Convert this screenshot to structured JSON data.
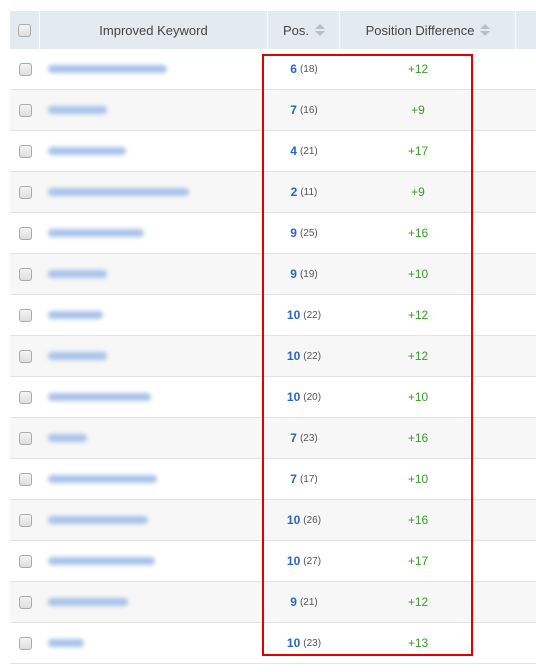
{
  "header": {
    "keyword_label": "Improved Keyword",
    "pos_label": "Pos.",
    "diff_label": "Position Difference"
  },
  "rows": [
    {
      "keyword": "[blurred]",
      "kw_len": 0.52,
      "pos": "6",
      "prev": "(18)",
      "diff": "+12"
    },
    {
      "keyword": "[blurred]",
      "kw_len": 0.26,
      "pos": "7",
      "prev": "(16)",
      "diff": "+9"
    },
    {
      "keyword": "[blurred]",
      "kw_len": 0.34,
      "pos": "4",
      "prev": "(21)",
      "diff": "+17"
    },
    {
      "keyword": "[blurred]",
      "kw_len": 0.62,
      "pos": "2",
      "prev": "(11)",
      "diff": "+9"
    },
    {
      "keyword": "[blurred]",
      "kw_len": 0.42,
      "pos": "9",
      "prev": "(25)",
      "diff": "+16"
    },
    {
      "keyword": "[blurred]",
      "kw_len": 0.26,
      "pos": "9",
      "prev": "(19)",
      "diff": "+10"
    },
    {
      "keyword": "[blurred]",
      "kw_len": 0.24,
      "pos": "10",
      "prev": "(22)",
      "diff": "+12"
    },
    {
      "keyword": "[blurred]",
      "kw_len": 0.26,
      "pos": "10",
      "prev": "(22)",
      "diff": "+12"
    },
    {
      "keyword": "[blurred]",
      "kw_len": 0.45,
      "pos": "10",
      "prev": "(20)",
      "diff": "+10"
    },
    {
      "keyword": "[blurred]",
      "kw_len": 0.17,
      "pos": "7",
      "prev": "(23)",
      "diff": "+16"
    },
    {
      "keyword": "[blurred]",
      "kw_len": 0.48,
      "pos": "7",
      "prev": "(17)",
      "diff": "+10"
    },
    {
      "keyword": "[blurred]",
      "kw_len": 0.44,
      "pos": "10",
      "prev": "(26)",
      "diff": "+16"
    },
    {
      "keyword": "[blurred]",
      "kw_len": 0.47,
      "pos": "10",
      "prev": "(27)",
      "diff": "+17"
    },
    {
      "keyword": "[blurred]",
      "kw_len": 0.35,
      "pos": "9",
      "prev": "(21)",
      "diff": "+12"
    },
    {
      "keyword": "[blurred]",
      "kw_len": 0.16,
      "pos": "10",
      "prev": "(23)",
      "diff": "+13"
    }
  ],
  "colors": {
    "pos": "#2a64c4",
    "diff": "#3a9a2a",
    "highlight": "#e00000"
  }
}
